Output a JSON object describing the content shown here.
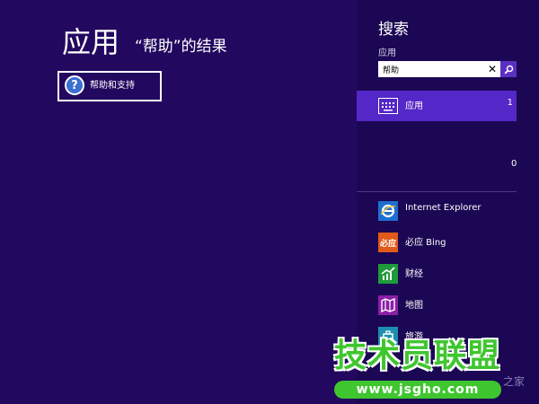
{
  "results": {
    "title": "应用",
    "subtitle": "“帮助”的结果",
    "items": [
      {
        "label": "帮助和支持",
        "icon": "help-question-icon"
      }
    ]
  },
  "search_pane": {
    "title": "搜索",
    "scope_label": "应用",
    "query": "帮助",
    "categories": [
      {
        "label": "应用",
        "count": "1",
        "icon": "apps-keyboard-icon"
      }
    ],
    "other_count": "0",
    "apps": [
      {
        "label": "Internet Explorer",
        "icon_text": "",
        "color": "#1e6fd1",
        "icon": "internet-explorer-icon"
      },
      {
        "label": "必应 Bing",
        "icon_text": "必应",
        "color": "#e05a1b",
        "icon": "bing-icon"
      },
      {
        "label": "财经",
        "icon_text": "",
        "color": "#1f9a3a",
        "icon": "finance-chart-icon"
      },
      {
        "label": "地图",
        "icon_text": "",
        "color": "#8b1fa8",
        "icon": "maps-icon"
      },
      {
        "label": "旅游",
        "icon_text": "",
        "color": "#1d8fb0",
        "icon": "travel-icon"
      }
    ]
  },
  "watermark": {
    "title": "技术员联盟",
    "url": "www.jsgho.com",
    "tail": "之家"
  },
  "colors": {
    "background": "#23085f",
    "pane": "#1b0753",
    "accent": "#5427c8",
    "watermark": "#3fc62f"
  }
}
